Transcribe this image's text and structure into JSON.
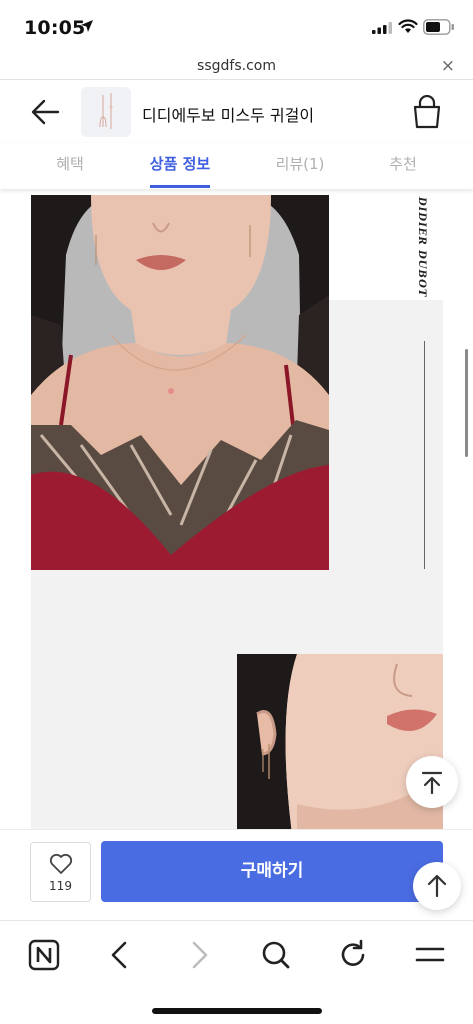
{
  "status_bar": {
    "time": "10:05"
  },
  "url_bar": {
    "url": "ssgdfs.com",
    "close": "×"
  },
  "header": {
    "title": "디디에두보 미스두 귀걸이"
  },
  "tabs": [
    {
      "label": "혜택",
      "active": false
    },
    {
      "label": "상품 정보",
      "active": true
    },
    {
      "label": "리뷰(1)",
      "active": false
    },
    {
      "label": "추천",
      "active": false
    }
  ],
  "content": {
    "brand_text": "DIDIER DUBOT"
  },
  "purchase_bar": {
    "like_count": "119",
    "buy_label": "구매하기"
  },
  "colors": {
    "accent": "#3f5fe0",
    "buy_button": "#4a6ce2"
  }
}
